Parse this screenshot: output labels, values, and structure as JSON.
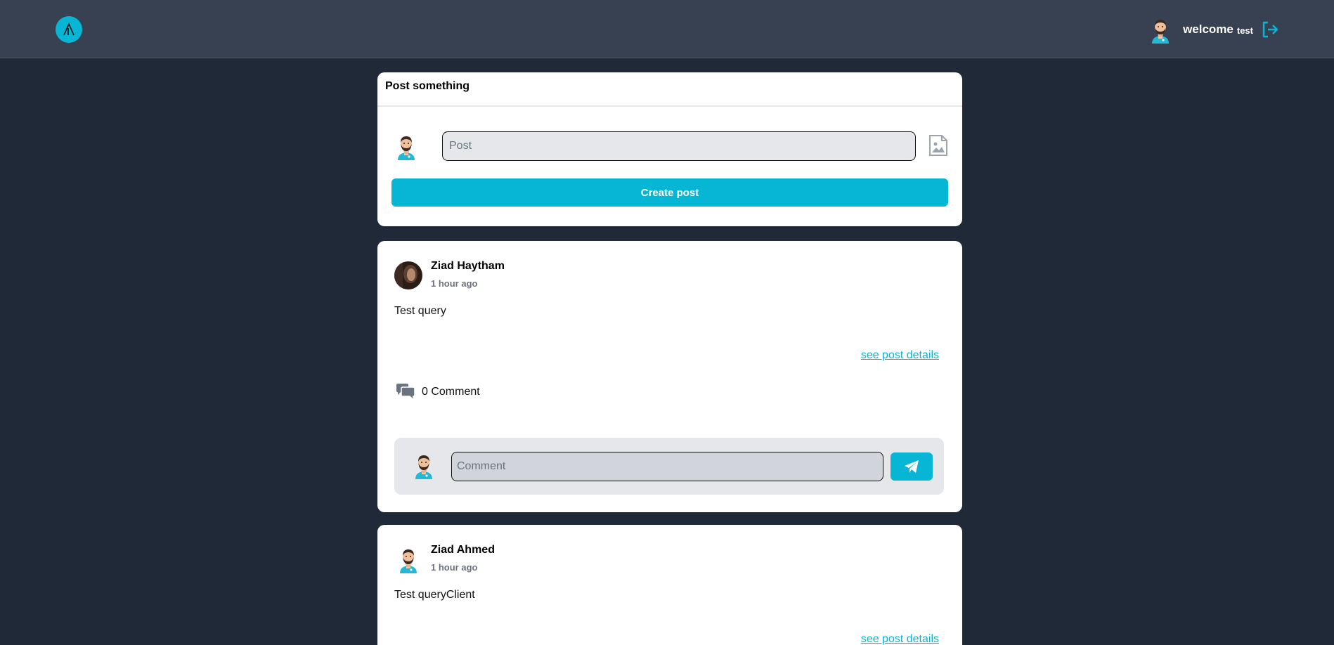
{
  "header": {
    "welcome_label": "welcome",
    "username": "test"
  },
  "compose": {
    "title": "Post something",
    "input_placeholder": "Post",
    "input_value": "",
    "submit_label": "Create post"
  },
  "posts": [
    {
      "author": "Ziad Haytham",
      "time": "1 hour ago",
      "body": "Test query",
      "details_link": "see post details",
      "comments_label": "0 Comment",
      "comment_placeholder": "Comment",
      "avatar": "photo-avatar"
    },
    {
      "author": "Ziad Ahmed",
      "time": "1 hour ago",
      "body": "Test queryClient",
      "details_link": "see post details",
      "avatar": "bearded-man-avatar"
    }
  ],
  "icons": {
    "logo": "app-logo-icon",
    "logout": "logout-icon",
    "image": "image-upload-icon",
    "comments": "comments-icon",
    "send": "paper-plane-icon"
  },
  "colors": {
    "background": "#1f2937",
    "header": "#374151",
    "accent": "#06b6d4",
    "card": "#ffffff"
  }
}
